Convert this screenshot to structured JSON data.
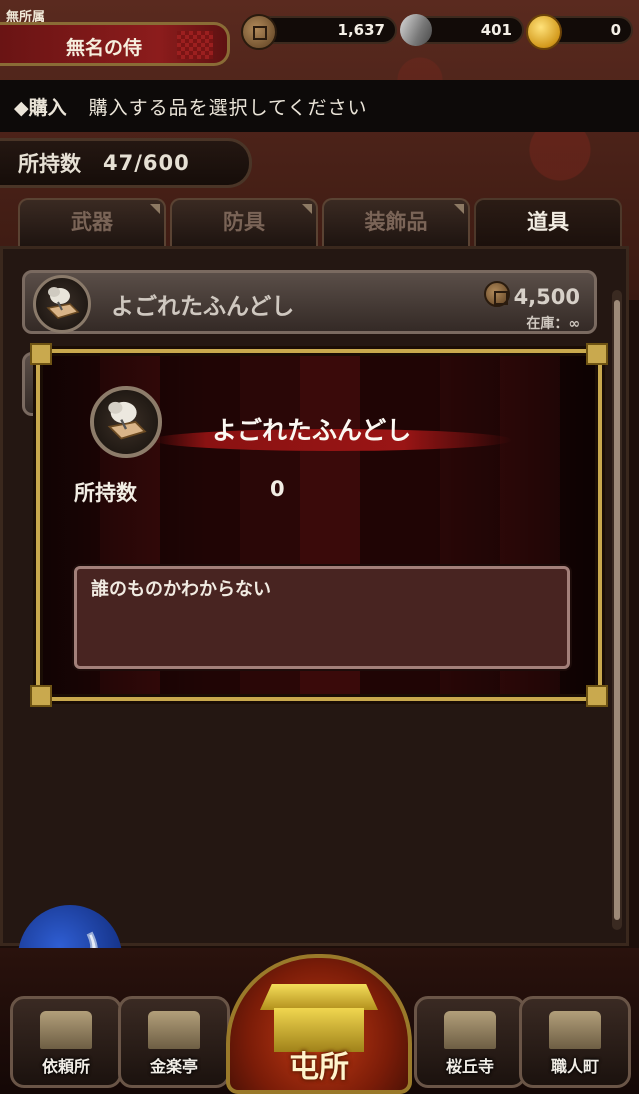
{
  "header": {
    "affiliation": "無所属",
    "player_name": "無名の侍",
    "currencies": [
      {
        "icon": "copper-coin-icon",
        "value": "1,637"
      },
      {
        "icon": "silver-ingot-icon",
        "value": "401"
      },
      {
        "icon": "gold-coin-icon",
        "value": "0"
      }
    ]
  },
  "instruction": {
    "label": "◆購入",
    "message": "購入する品を選択してください"
  },
  "holdings": {
    "label": "所持数",
    "value": "47/600"
  },
  "tabs": [
    {
      "label": "武器",
      "active": false
    },
    {
      "label": "防具",
      "active": false
    },
    {
      "label": "装飾品",
      "active": false
    },
    {
      "label": "道具",
      "active": true
    }
  ],
  "item_list": [
    {
      "name": "よごれたふんどし",
      "price": "4,500",
      "stock": "在庫：∞",
      "icon": "fundoshi-icon"
    }
  ],
  "modal": {
    "title": "よごれたふんどし",
    "owned_label": "所持数",
    "owned_value": "0",
    "description": "誰のものかわからない"
  },
  "bottom_nav": [
    {
      "label": "依頼所",
      "icon": "request-office-icon"
    },
    {
      "label": "金楽亭",
      "icon": "kinrakutei-icon"
    },
    {
      "label": "屯所",
      "icon": "barracks-icon"
    },
    {
      "label": "桜丘寺",
      "icon": "temple-icon"
    },
    {
      "label": "職人町",
      "icon": "craftsman-town-icon"
    }
  ],
  "colors": {
    "accent_gold": "#c9a94e",
    "name_plate_red": "#8c1c1c",
    "back_button_blue": "#2f5ed3"
  }
}
